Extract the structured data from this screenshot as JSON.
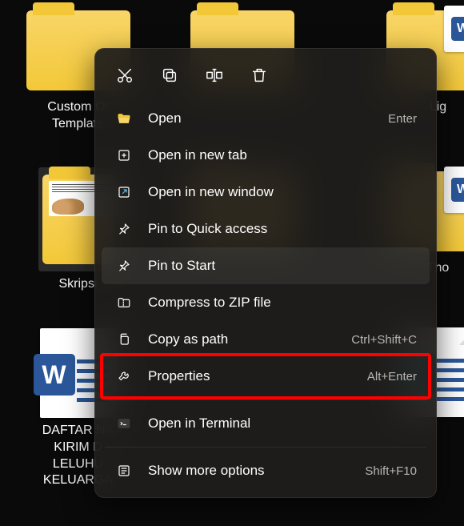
{
  "desktop": {
    "items": [
      {
        "label": "Custom Of\nTemplate"
      },
      {
        "label": ""
      },
      {
        "label": "Lig"
      },
      {
        "label": "Skripsi"
      },
      {
        "label": ""
      },
      {
        "label": "Tho"
      },
      {
        "label": "DAFTAR NA\nKIRIM D\nLELUHU\nKELUARGA "
      },
      {
        "label": ""
      }
    ]
  },
  "context_menu": {
    "quick_actions": [
      "cut",
      "copy",
      "rename",
      "delete"
    ],
    "items": [
      {
        "icon": "folder-open-icon",
        "label": "Open",
        "hint": "Enter"
      },
      {
        "icon": "new-tab-icon",
        "label": "Open in new tab",
        "hint": ""
      },
      {
        "icon": "external-icon",
        "label": "Open in new window",
        "hint": ""
      },
      {
        "icon": "pin-icon",
        "label": "Pin to Quick access",
        "hint": ""
      },
      {
        "icon": "pin-start-icon",
        "label": "Pin to Start",
        "hint": "",
        "hovered": true
      },
      {
        "icon": "zip-icon",
        "label": "Compress to ZIP file",
        "hint": ""
      },
      {
        "icon": "copypath-icon",
        "label": "Copy as path",
        "hint": "Ctrl+Shift+C"
      },
      {
        "icon": "wrench-icon",
        "label": "Properties",
        "hint": "Alt+Enter",
        "highlight": true
      },
      {
        "icon": "terminal-icon",
        "label": "Open in Terminal",
        "hint": ""
      },
      {
        "icon": "more-icon",
        "label": "Show more options",
        "hint": "Shift+F10"
      }
    ],
    "separators_after": [
      7,
      8
    ]
  },
  "colors": {
    "folder": "#f3c838",
    "word_blue": "#2b579a",
    "highlight": "#ff0000",
    "menu_bg": "#201e1c"
  }
}
